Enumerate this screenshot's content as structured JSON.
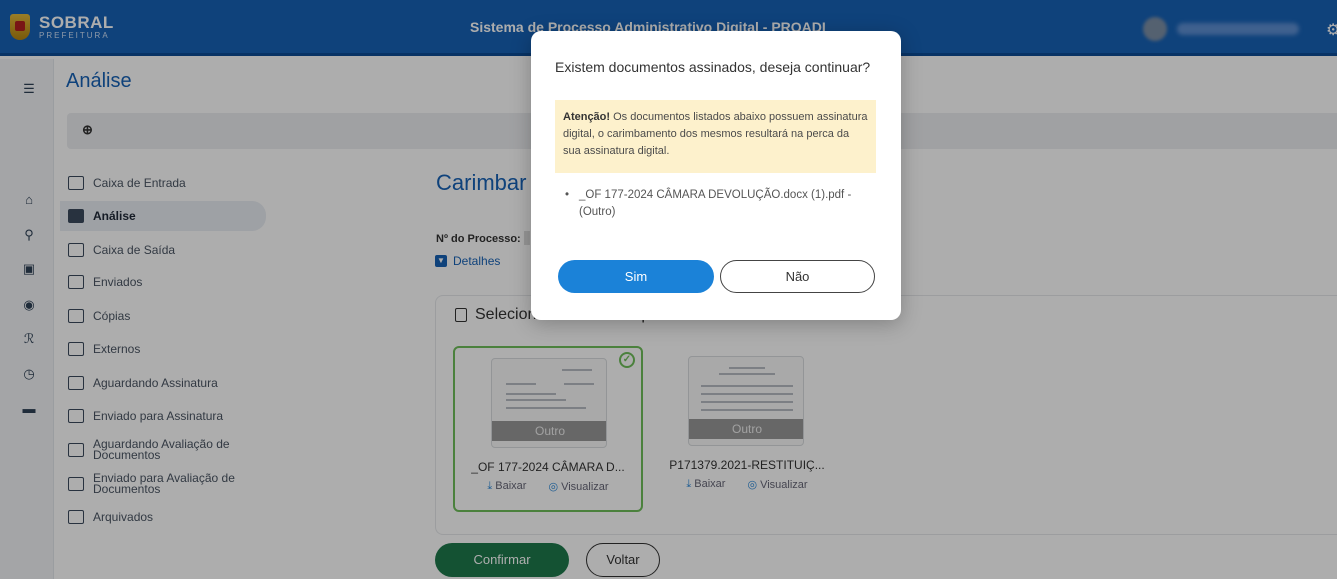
{
  "header": {
    "logo_title": "SOBRAL",
    "logo_subtitle": "PREFEITURA",
    "app_title": "Sistema de Processo Administrativo Digital - PROADI"
  },
  "page": {
    "title": "Análise"
  },
  "sidebar": {
    "items": [
      {
        "label": "Caixa de Entrada"
      },
      {
        "label": "Análise"
      },
      {
        "label": "Caixa de Saída"
      },
      {
        "label": "Enviados"
      },
      {
        "label": "Cópias"
      },
      {
        "label": "Externos"
      },
      {
        "label": "Aguardando Assinatura"
      },
      {
        "label": "Enviado para Assinatura"
      },
      {
        "label": "Aguardando Avaliação de Documentos"
      },
      {
        "label": "Enviado para Avaliação de Documentos"
      },
      {
        "label": "Arquivados"
      }
    ],
    "active_index": 1
  },
  "content": {
    "title": "Carimbar D",
    "process_label": "Nº do Processo:",
    "details_link": "Detalhes",
    "panel_title": "Selecione documentos para o carimbamento:",
    "documents": [
      {
        "name": "_OF 177-2024 CÂMARA D...",
        "badge": "Outro",
        "download": "Baixar",
        "view": "Visualizar",
        "selected": true
      },
      {
        "name": "P171379.2021-RESTITUIÇ...",
        "badge": "Outro",
        "download": "Baixar",
        "view": "Visualizar",
        "selected": false
      }
    ],
    "confirm_button": "Confirmar",
    "back_button": "Voltar"
  },
  "modal": {
    "title": "Existem documentos assinados, deseja continuar?",
    "warning_strong": "Atenção!",
    "warning_text": " Os documentos listados abaixo possuem assinatura digital, o carimbamento dos mesmos resultará na perca da sua assinatura digital.",
    "documents": [
      "_OF 177-2024 CÂMARA DEVOLUÇÃO.docx (1).pdf - (Outro)"
    ],
    "yes_button": "Sim",
    "no_button": "Não"
  },
  "colors": {
    "primary": "#1762b6",
    "confirm": "#1e7a4c",
    "selected_border": "#6fbf5b",
    "warning_bg": "#fdf1cc",
    "modal_yes": "#1b82d8"
  }
}
